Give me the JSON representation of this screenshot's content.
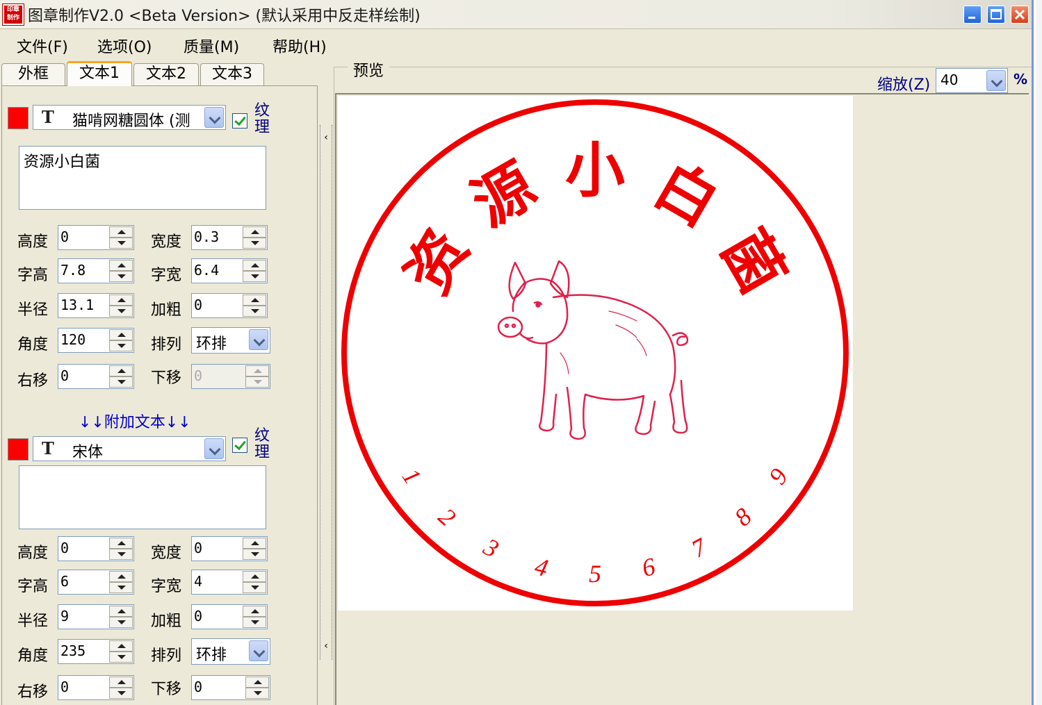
{
  "window": {
    "title": "图章制作V2.0 <Beta Version> (默认采用中反走样绘制)",
    "app_icon_text": [
      "印章",
      "制作"
    ]
  },
  "menu": [
    {
      "label": "文件(F)"
    },
    {
      "label": "选项(O)"
    },
    {
      "label": "质量(M)"
    },
    {
      "label": "帮助(H)"
    }
  ],
  "tabs": [
    {
      "label": "外框"
    },
    {
      "label": "文本1"
    },
    {
      "label": "文本2"
    },
    {
      "label": "文本3"
    }
  ],
  "text1": {
    "color": "#ff0000",
    "font_name": "猫啃网糖圆体 (测",
    "texture_label": "纹理",
    "texture_checked": true,
    "content": "资源小白菌",
    "fields": {
      "height": {
        "label": "高度",
        "value": "0"
      },
      "width": {
        "label": "宽度",
        "value": "0.3"
      },
      "char_height": {
        "label": "字高",
        "value": "7.8"
      },
      "char_width": {
        "label": "字宽",
        "value": "6.4"
      },
      "radius": {
        "label": "半径",
        "value": "13.1"
      },
      "bold": {
        "label": "加粗",
        "value": "0"
      },
      "angle": {
        "label": "角度",
        "value": "120"
      },
      "arrange": {
        "label": "排列",
        "value": "环排"
      },
      "shift_right": {
        "label": "右移",
        "value": "0"
      },
      "shift_down": {
        "label": "下移",
        "value": "0"
      }
    }
  },
  "additional_header": "↓↓附加文本↓↓",
  "text_extra": {
    "color": "#ff0000",
    "font_name": "宋体",
    "texture_label": "纹理",
    "texture_checked": true,
    "content": "",
    "fields": {
      "height": {
        "label": "高度",
        "value": "0"
      },
      "width": {
        "label": "宽度",
        "value": "0"
      },
      "char_height": {
        "label": "字高",
        "value": "6"
      },
      "char_width": {
        "label": "字宽",
        "value": "4"
      },
      "radius": {
        "label": "半径",
        "value": "9"
      },
      "bold": {
        "label": "加粗",
        "value": "0"
      },
      "angle": {
        "label": "角度",
        "value": "235"
      },
      "arrange": {
        "label": "排列",
        "value": "环排"
      },
      "shift_right": {
        "label": "右移",
        "value": "0"
      },
      "shift_down": {
        "label": "下移",
        "value": "0"
      }
    }
  },
  "preview": {
    "title": "预览",
    "zoom_label": "缩放(Z)",
    "zoom_value": "40",
    "zoom_unit": "%",
    "stamp": {
      "color": "#ee0000",
      "top_text": [
        "资",
        "源",
        "小",
        "白",
        "菌"
      ],
      "bottom_digits": [
        "1",
        "2",
        "3",
        "4",
        "5",
        "6",
        "7",
        "8",
        "9"
      ],
      "center_image": "pig-illustration"
    }
  }
}
